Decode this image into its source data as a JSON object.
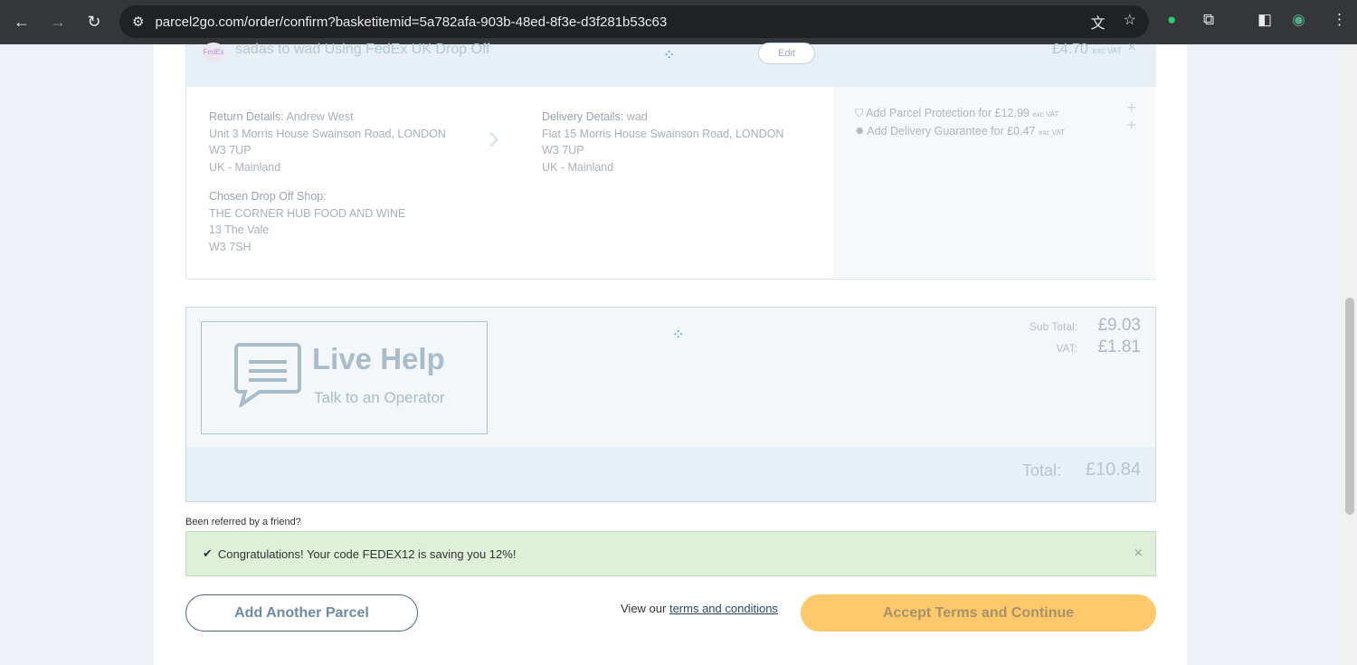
{
  "browser": {
    "url": "parcel2go.com/order/confirm?basketitemid=5a782afa-903b-48ed-8f3e-d3f281b53c63"
  },
  "item": {
    "title": "sadas to wad Using FedEx UK Drop Off",
    "edit": "Edit",
    "price": "£4.70",
    "price_note": "exc VAT",
    "remove": "×",
    "return_label": "Return Details:",
    "return_name": "Andrew West",
    "return_lines": [
      "Unit 3 Morris House Swainson Road, LONDON",
      "W3 7UP",
      "UK - Mainland"
    ],
    "delivery_label": "Delivery Details:",
    "delivery_name": "wad",
    "delivery_lines": [
      "Flat 15 Morris House Swainson Road, LONDON",
      "W3 7UP",
      "UK - Mainland"
    ],
    "shop_label": "Chosen Drop Off Shop:",
    "shop_lines": [
      "THE CORNER HUB FOOD AND WINE",
      "13 The Vale",
      "W3 7SH"
    ],
    "extras": [
      {
        "label": "Add Parcel Protection for £12.99",
        "note": "exc VAT"
      },
      {
        "label": "Add Delivery Guarantee for £0.47",
        "note": "exc VAT"
      }
    ]
  },
  "summary": {
    "live_title": "Live Help",
    "live_sub": "Talk to an Operator",
    "subtotal_label": "Sub Total:",
    "subtotal": "£9.03",
    "vat_label": "VAT:",
    "vat": "£1.81",
    "total_label": "Total:",
    "total": "£10.84"
  },
  "referral": "Been referred by a friend?",
  "promo": {
    "message": "Congratulations! Your code FEDEX12 is saving you 12%!",
    "close": "×"
  },
  "actions": {
    "add_parcel": "Add Another Parcel",
    "terms_prefix": "View our",
    "terms_link": "terms and conditions",
    "accept": "Accept Terms and Continue"
  }
}
